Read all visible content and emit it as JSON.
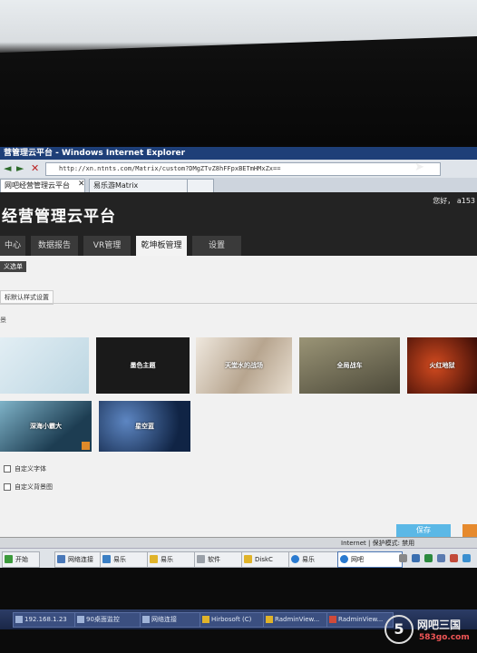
{
  "ie": {
    "window_title": "营管理云平台 - Windows Internet Explorer",
    "url": "http://xn.ntnts.com/Matrix/custom?DMgZTvZ8hFFpxBETmHMxZx==",
    "tabs": [
      {
        "label": "网吧经营管理云平台"
      },
      {
        "label": "易乐游Matrix"
      }
    ],
    "status_text": "Internet | 保护模式: 禁用"
  },
  "page": {
    "title": "经营管理云平台",
    "greeting": "您好， a153",
    "nav": [
      {
        "label": "中心"
      },
      {
        "label": "数据报告"
      },
      {
        "label": "VR管理"
      },
      {
        "label": "乾坤板管理",
        "active": true
      },
      {
        "label": "设置"
      }
    ],
    "submenu_button": "义选单",
    "section_tab": "标默认样式设置",
    "theme_label": "景",
    "themes": [
      {
        "name": "",
        "color": "#cfe2ec"
      },
      {
        "name": "墨色主题",
        "color": "#1a1a1a"
      },
      {
        "name": "天堂水的战场",
        "color": "#d9cfc2"
      },
      {
        "name": "全局战车",
        "color": "#6f6a55"
      },
      {
        "name": "火红地狱",
        "color": "#6b1d12"
      },
      {
        "name": "深海小霸大",
        "color": "#2d5e7a"
      },
      {
        "name": "星空蓝",
        "color": "#1d3f73"
      }
    ],
    "options": [
      {
        "label": "自定义字体"
      },
      {
        "label": "自定义背景图"
      }
    ],
    "save_label": "保存"
  },
  "taskbar": {
    "items": [
      {
        "label": "开始"
      },
      {
        "label": "网络连接"
      },
      {
        "label": "易乐"
      },
      {
        "label": "易乐"
      },
      {
        "label": "软件"
      },
      {
        "label": "DiskC"
      },
      {
        "label": "易乐"
      },
      {
        "label": "网吧"
      }
    ]
  },
  "taskbar2": {
    "items": [
      {
        "label": "192.168.1.23"
      },
      {
        "label": "90桌面监控"
      },
      {
        "label": "网络连接"
      },
      {
        "label": "Hirbosoft (C)"
      },
      {
        "label": "RadminView..."
      },
      {
        "label": "RadminView..."
      }
    ]
  },
  "watermark": {
    "logo_glyph": "5",
    "name": "网吧三国",
    "url": "583go.com"
  },
  "colors": {
    "header_bg": "#232323",
    "active_tab_bg": "#f3f3f3",
    "save_button": "#5bb8e6",
    "ie_title_bg": "#1e3f78"
  }
}
